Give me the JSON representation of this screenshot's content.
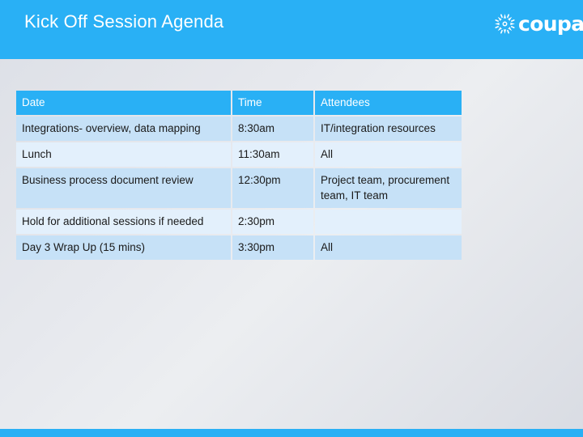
{
  "slide": {
    "title": "Kick Off Session Agenda",
    "brand": {
      "wordmark": "coupa",
      "mark_icon": "coupa-starburst-icon"
    },
    "colors": {
      "brand_blue": "#29b0f5",
      "row_dark": "#c6e1f7",
      "row_light": "#e3f0fc",
      "header_text": "#ffffff",
      "body_text": "#1a1a1a",
      "background_gray": "#e3e5ea"
    }
  },
  "table": {
    "headers": [
      "Date",
      "Time",
      "Attendees"
    ],
    "rows": [
      {
        "date": "Integrations- overview, data mapping",
        "time": "8:30am",
        "attendees": "IT/integration resources"
      },
      {
        "date": "Lunch",
        "time": "11:30am",
        "attendees": "All"
      },
      {
        "date": "Business process document review",
        "time": "12:30pm",
        "attendees": "Project team, procurement team, IT team"
      },
      {
        "date": "Hold for additional sessions if needed",
        "time": "2:30pm",
        "attendees": ""
      },
      {
        "date": "Day 3 Wrap Up (15 mins)",
        "time": "3:30pm",
        "attendees": "All"
      }
    ]
  }
}
